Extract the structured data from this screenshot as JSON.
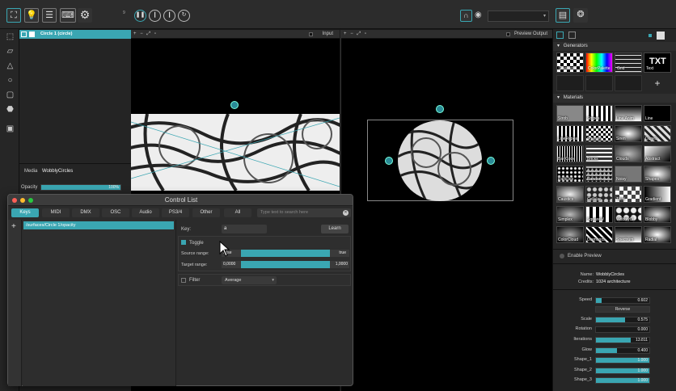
{
  "topbar": {
    "layer_num": "9",
    "dropdown_value": ""
  },
  "surfaces": {
    "layer_label": "Circle 1 (circle)",
    "media_label": "Media",
    "media_value": "WobblyCircles",
    "opacity_label": "Opacity",
    "opacity_value": "100%",
    "opacity_fraction": 1.0
  },
  "input_panel": {
    "title": "Input"
  },
  "preview_panel": {
    "title": "Preview Output"
  },
  "control_list": {
    "title": "Control List",
    "tabs": [
      {
        "label": "Keys",
        "active": true
      },
      {
        "label": "MIDI",
        "active": false
      },
      {
        "label": "DMX",
        "active": false
      },
      {
        "label": "OSC",
        "active": false
      },
      {
        "label": "Audio",
        "active": false
      },
      {
        "label": "PS3/4",
        "active": false
      },
      {
        "label": "Other",
        "active": false
      },
      {
        "label": "All",
        "active": false
      }
    ],
    "search_placeholder": "Type text to search here",
    "list_item": "/surfaces/Circle 1/opacity",
    "key_label": "Key:",
    "key_value": "a",
    "learn_label": "Learn",
    "toggle_label": "Toggle",
    "source_range_label": "Source range:",
    "source_min": "false",
    "source_max": "true",
    "target_range_label": "Target range:",
    "target_min": "0,0000",
    "target_max": "1,0000",
    "filter_label": "Filter",
    "filter_value": "Average"
  },
  "generators": {
    "title": "Generators",
    "items": [
      "Checkers",
      "ColorPalette",
      "Grid",
      "Text"
    ]
  },
  "materials": {
    "title": "Materials",
    "items": [
      "Strob",
      "Stripes",
      "Line Anim",
      "Line",
      "LineRepea",
      "Squares",
      "Siren",
      "Dunes",
      "Bar Code",
      "Bricks",
      "Clouds",
      "Abstract",
      "Particles",
      "Random",
      "Noisy",
      "Shapes",
      "Caustics",
      "Cellular",
      "Tiled",
      "Gradient",
      "Simplex",
      "SquareW",
      "WobblyCi",
      "Blobby",
      "ColorCloud",
      "Diamonds",
      "Spectrum",
      "Radial"
    ]
  },
  "properties": {
    "enable_preview_label": "Enable Preview",
    "name_label": "Name:",
    "name_value": "WobblyCircles",
    "credits_label": "Credits:",
    "credits_value": "1024 architecture",
    "reverse_label": "Reverse",
    "params": [
      {
        "label": "Speed",
        "value": "0.602",
        "fraction": 0.1
      },
      {
        "label": "Scale",
        "value": "0.575",
        "fraction": 0.55
      },
      {
        "label": "Rotation",
        "value": "0.000",
        "fraction": 0.0
      },
      {
        "label": "Iterations",
        "value": "13.811",
        "fraction": 0.65
      },
      {
        "label": "Glow",
        "value": "0.400",
        "fraction": 0.4
      },
      {
        "label": "Shape_1",
        "value": "1.000",
        "fraction": 1.0
      },
      {
        "label": "Shape_2",
        "value": "1.000",
        "fraction": 1.0
      },
      {
        "label": "Shape_3",
        "value": "1.000",
        "fraction": 1.0
      }
    ]
  }
}
